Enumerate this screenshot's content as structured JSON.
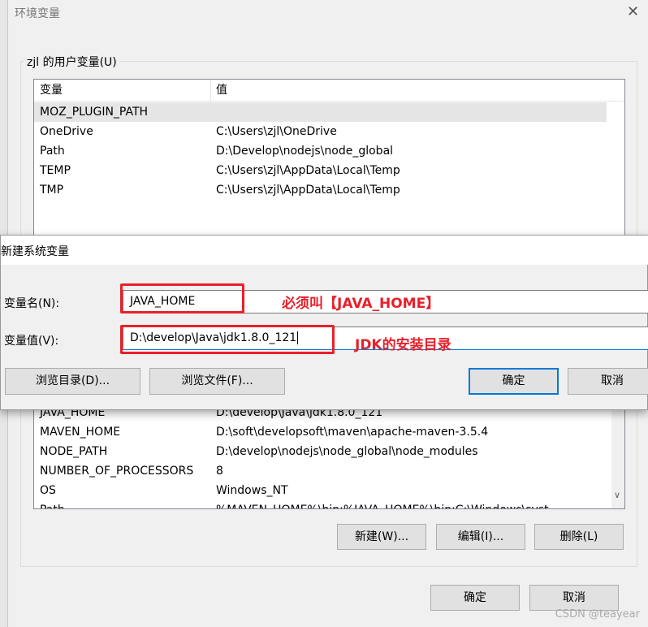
{
  "window": {
    "title": "环境变量",
    "close": "✕"
  },
  "user_vars": {
    "group_label": "zjl 的用户变量(U)",
    "columns": [
      "变量",
      "值"
    ],
    "rows": [
      {
        "name": "MOZ_PLUGIN_PATH",
        "value": ""
      },
      {
        "name": "OneDrive",
        "value": "C:\\Users\\zjl\\OneDrive"
      },
      {
        "name": "Path",
        "value": "D:\\Develop\\nodejs\\node_global"
      },
      {
        "name": "TEMP",
        "value": "C:\\Users\\zjl\\AppData\\Local\\Temp"
      },
      {
        "name": "TMP",
        "value": "C:\\Users\\zjl\\AppData\\Local\\Temp"
      }
    ]
  },
  "system_vars": {
    "rows": [
      {
        "name": "JAVA_HOME",
        "value": "D:\\develop\\Java\\jdk1.8.0_121"
      },
      {
        "name": "MAVEN_HOME",
        "value": "D:\\soft\\developsoft\\maven\\apache-maven-3.5.4"
      },
      {
        "name": "NODE_PATH",
        "value": "D:\\develop\\nodejs\\node_global\\node_modules"
      },
      {
        "name": "NUMBER_OF_PROCESSORS",
        "value": "8"
      },
      {
        "name": "OS",
        "value": "Windows_NT"
      },
      {
        "name": "Path",
        "value": "%MAVEN_HOME%\\bin;%JAVA_HOME%\\bin;C:\\Windows\\syst"
      }
    ],
    "buttons": {
      "new": "新建(W)...",
      "edit": "编辑(I)...",
      "delete": "删除(L)"
    }
  },
  "footer": {
    "ok": "确定",
    "cancel": "取消"
  },
  "dialog": {
    "title": "新建系统变量",
    "name_label": "变量名(N):",
    "name_value": "JAVA_HOME",
    "value_label": "变量值(V):",
    "value_value": "D:\\develop\\Java\\jdk1.8.0_121",
    "browse_dir": "浏览目录(D)...",
    "browse_file": "浏览文件(F)...",
    "ok": "确定",
    "cancel": "取消"
  },
  "annotations": {
    "name_note": "必须叫【JAVA_HOME】",
    "value_note": "JDK的安装目录",
    "color": "#e8202a"
  },
  "watermark": "CSDN @teayear"
}
